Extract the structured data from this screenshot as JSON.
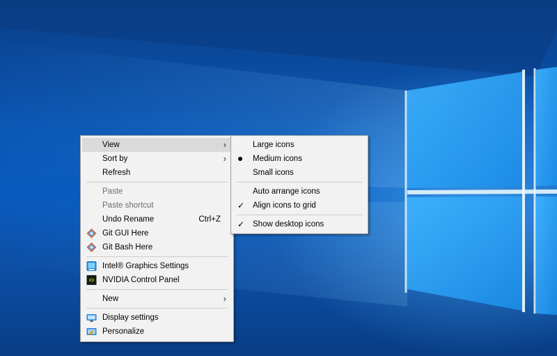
{
  "main_menu": {
    "items": [
      {
        "label": "View"
      },
      {
        "label": "Sort by"
      },
      {
        "label": "Refresh"
      },
      {
        "label": "Paste"
      },
      {
        "label": "Paste shortcut"
      },
      {
        "label": "Undo Rename",
        "shortcut": "Ctrl+Z"
      },
      {
        "label": "Git GUI Here"
      },
      {
        "label": "Git Bash Here"
      },
      {
        "label": "Intel® Graphics Settings"
      },
      {
        "label": "NVIDIA Control Panel"
      },
      {
        "label": "New"
      },
      {
        "label": "Display settings"
      },
      {
        "label": "Personalize"
      }
    ]
  },
  "view_submenu": {
    "items": [
      {
        "label": "Large icons"
      },
      {
        "label": "Medium icons",
        "selected": true
      },
      {
        "label": "Small icons"
      },
      {
        "label": "Auto arrange icons"
      },
      {
        "label": "Align icons to grid",
        "checked": true
      },
      {
        "label": "Show desktop icons",
        "checked": true
      }
    ]
  },
  "icons": {
    "submenu_arrow": "›",
    "check": "✓",
    "git": "git-logo-icon",
    "intel": "intel-graphics-icon",
    "nvidia": "nvidia-icon",
    "display": "display-settings-icon",
    "personalize": "personalize-icon"
  },
  "colors": {
    "menu_bg": "#f2f2f2",
    "highlight": "#dadada",
    "disabled_text": "#6d6d6d",
    "desktop_blue": "#0b57b4"
  }
}
